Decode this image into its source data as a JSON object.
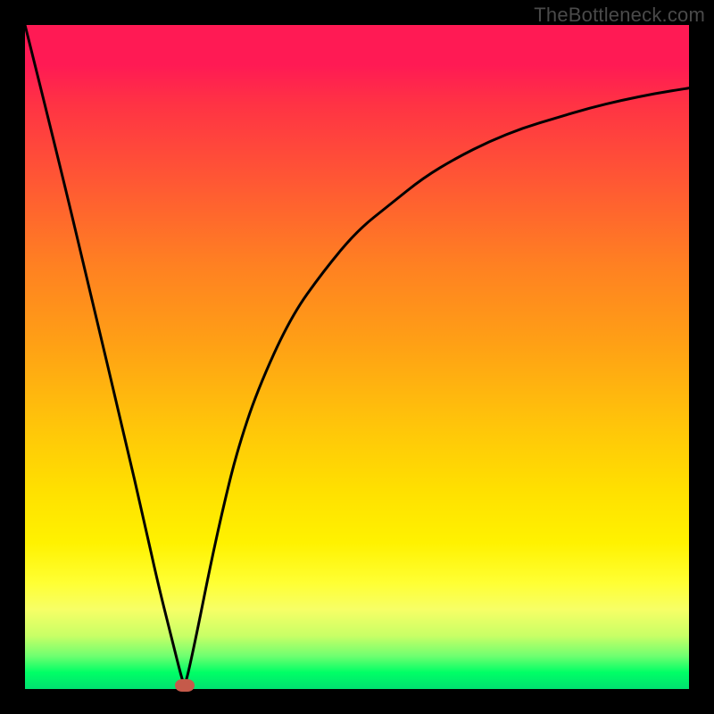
{
  "attribution": "TheBottleneck.com",
  "chart_data": {
    "type": "line",
    "title": "",
    "xlabel": "",
    "ylabel": "",
    "xlim": [
      0,
      100
    ],
    "ylim": [
      0,
      100
    ],
    "grid": false,
    "legend": false,
    "series": [
      {
        "name": "bottleneck-curve",
        "x": [
          0,
          5,
          10,
          15,
          18,
          20,
          22,
          23.5,
          24,
          24.5,
          26,
          28,
          30,
          32,
          35,
          40,
          45,
          50,
          55,
          60,
          65,
          70,
          75,
          80,
          85,
          90,
          95,
          100
        ],
        "values": [
          100,
          80,
          59,
          38,
          25,
          16,
          8,
          2,
          0.5,
          2,
          9,
          19,
          28,
          36,
          45,
          56,
          63,
          69,
          73,
          77,
          80,
          82.5,
          84.5,
          86,
          87.5,
          88.7,
          89.7,
          90.5
        ]
      }
    ],
    "marker": {
      "x": 24,
      "y": 0.5,
      "color": "#c55a4a"
    },
    "background_gradient": {
      "top": "#ff1a54",
      "mid": "#ffd400",
      "bottom": "#00ff66"
    }
  }
}
